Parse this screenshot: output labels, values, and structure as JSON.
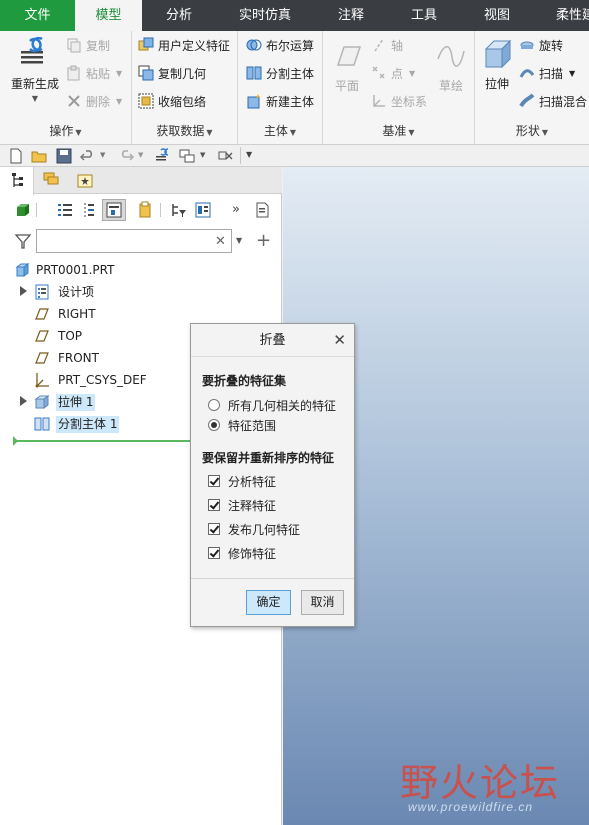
{
  "tabs": [
    {
      "label": "文件"
    },
    {
      "label": "模型"
    },
    {
      "label": "分析"
    },
    {
      "label": "实时仿真"
    },
    {
      "label": "注释"
    },
    {
      "label": "工具"
    },
    {
      "label": "视图"
    },
    {
      "label": "柔性建"
    }
  ],
  "ribbon": {
    "operations": {
      "label": "操作",
      "regenerate": "重新生成",
      "copy": "复制",
      "paste": "粘贴",
      "delete": "删除"
    },
    "get_data": {
      "label": "获取数据",
      "udf": "用户定义特征",
      "copy_geom": "复制几何",
      "shrinkwrap": "收缩包络"
    },
    "body": {
      "label": "主体",
      "boolean": "布尔运算",
      "split": "分割主体",
      "new_body": "新建主体"
    },
    "datum": {
      "label": "基准",
      "plane": "平面",
      "axis": "轴",
      "point": "点",
      "csys": "坐标系",
      "sketch": "草绘"
    },
    "shapes": {
      "label": "形状",
      "extrude": "拉伸",
      "revolve": "旋转",
      "sweep": "扫描",
      "swept_blend": "扫描混合"
    }
  },
  "tree": {
    "search_placeholder": "",
    "nodes": [
      {
        "label": "PRT0001.PRT"
      },
      {
        "label": "设计项"
      },
      {
        "label": "RIGHT"
      },
      {
        "label": "TOP"
      },
      {
        "label": "FRONT"
      },
      {
        "label": "PRT_CSYS_DEF"
      },
      {
        "label": "拉伸 1"
      },
      {
        "label": "分割主体 1"
      }
    ]
  },
  "dialog": {
    "title": "折叠",
    "section1": "要折叠的特征集",
    "radio_all": "所有几何相关的特征",
    "radio_range": "特征范围",
    "radio_selected": "range",
    "section2": "要保留并重新排序的特征",
    "check_analysis": "分析特征",
    "check_annotation": "注释特征",
    "check_publish": "发布几何特征",
    "check_cosmetic": "修饰特征",
    "ok": "确定",
    "cancel": "取消"
  },
  "watermark": {
    "title": "野火论坛",
    "url": "www.proewildfire.cn"
  },
  "colors": {
    "file_tab": "#1f9a3e",
    "active_tab_text": "#1f8f3a",
    "selection": "#cde8fb",
    "tabbar": "#3a3d42"
  }
}
